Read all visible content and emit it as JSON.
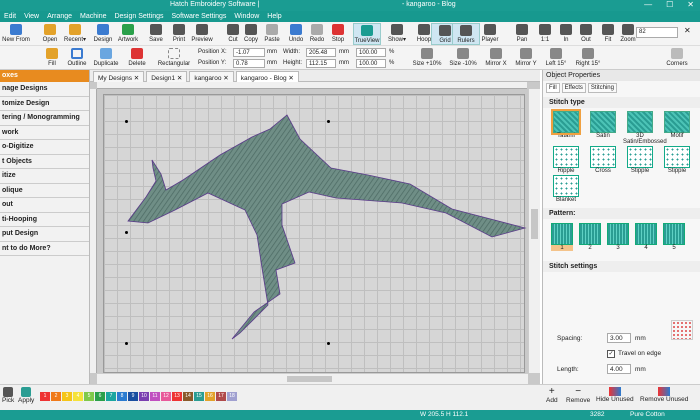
{
  "window": {
    "title_left": "Hatch Embroidery Software |",
    "title_right": "- kangaroo - Blog",
    "controls": [
      "—",
      "☐",
      "✕"
    ]
  },
  "menu": [
    "Edit",
    "View",
    "Arrange",
    "Machine",
    "Design Settings",
    "Software Settings",
    "Window",
    "Help"
  ],
  "toolbar1": [
    {
      "label": "New From",
      "icon": "new-icon",
      "color": "#3b7bd0"
    },
    {
      "label": "Open",
      "icon": "open-folder-icon",
      "color": "#e3a22a"
    },
    {
      "label": "Recent▾",
      "icon": "recent-icon",
      "color": "#e3a22a"
    },
    {
      "label": "Design",
      "icon": "design-icon",
      "color": "#3b7bd0"
    },
    {
      "label": "Artwork",
      "icon": "artwork-icon",
      "color": "#2aa04a"
    },
    {
      "label": "Save",
      "icon": "save-icon",
      "color": "#555"
    },
    {
      "label": "Print",
      "icon": "print-icon",
      "color": "#555"
    },
    {
      "label": "Preview",
      "icon": "preview-icon",
      "color": "#555"
    },
    {
      "label": "Cut",
      "icon": "cut-icon",
      "color": "#555"
    },
    {
      "label": "Copy",
      "icon": "copy-icon",
      "color": "#555"
    },
    {
      "label": "Paste",
      "icon": "paste-icon",
      "color": "#aaa"
    },
    {
      "label": "Undo",
      "icon": "undo-icon",
      "color": "#3b7bd0"
    },
    {
      "label": "Redo",
      "icon": "redo-icon",
      "color": "#aaa"
    },
    {
      "label": "Stop",
      "icon": "stop-icon",
      "color": "#d33"
    },
    {
      "label": "TrueView",
      "icon": "trueview-icon",
      "color": "#1a9c92"
    },
    {
      "label": "Show▾",
      "icon": "show-icon",
      "color": "#555"
    },
    {
      "label": "Hoop",
      "icon": "hoop-icon",
      "color": "#555"
    },
    {
      "label": "Grid",
      "icon": "grid-icon",
      "color": "#555"
    },
    {
      "label": "Rulers",
      "icon": "rulers-icon",
      "color": "#555"
    },
    {
      "label": "Player",
      "icon": "player-icon",
      "color": "#555"
    },
    {
      "label": "Pan",
      "icon": "pan-icon",
      "color": "#555"
    },
    {
      "label": "1:1",
      "icon": "zoom-1to1-icon",
      "color": "#555"
    },
    {
      "label": "In",
      "icon": "zoom-in-icon",
      "color": "#555"
    },
    {
      "label": "Out",
      "icon": "zoom-out-icon",
      "color": "#555"
    },
    {
      "label": "Fit",
      "icon": "zoom-fit-icon",
      "color": "#555"
    },
    {
      "label": "Zoom",
      "icon": "zoom-icon",
      "color": "#555"
    }
  ],
  "toolbar1_active": [
    "TrueView",
    "Grid",
    "Rulers"
  ],
  "zoom_value": "82",
  "toolbar2": {
    "buttons": [
      {
        "label": "Fill"
      },
      {
        "label": "Outline"
      },
      {
        "label": "Duplicate"
      },
      {
        "label": "Delete"
      },
      {
        "label": "Rectangular"
      }
    ],
    "position_x_label": "Position X:",
    "position_x": "-1.07",
    "position_y_label": "Position Y:",
    "position_y": "0.78",
    "unit": "mm",
    "width_label": "Width:",
    "width": "205.48",
    "height_label": "Height:",
    "height": "112.15",
    "scale_w": "100.00",
    "scale_h": "100.00",
    "percent": "%",
    "size_buttons": [
      "Size +10%",
      "Size -10%",
      "Mirror X",
      "Mirror Y",
      "Left 15°",
      "Right 15°",
      "Corners"
    ]
  },
  "left_panel": {
    "header": "oxes",
    "items": [
      "nage Designs",
      "tomize Design",
      "tering / Monogramming",
      "work",
      "o-Digitize",
      "t Objects",
      "itize",
      "olique",
      "out",
      "ti-Hooping",
      "put Design",
      "nt to do More?"
    ]
  },
  "tabs": [
    {
      "label": "My Designs ✕",
      "active": false
    },
    {
      "label": "Design1 ✕",
      "active": false
    },
    {
      "label": "kangaroo ✕",
      "active": false
    },
    {
      "label": "kangaroo - Blog ✕",
      "active": true
    }
  ],
  "right_panel": {
    "title": "Object Properties",
    "tabs": [
      "Fill",
      "Effects",
      "Stitching"
    ],
    "stitch_type_label": "Stitch type",
    "stitch_types": [
      "Tatami",
      "Satin",
      "3D Satin/Embossed",
      "Motif",
      "Ripple",
      "Cross",
      "Stipple",
      "Stipple",
      "Blanket"
    ],
    "pattern_label": "Pattern:",
    "patterns": [
      "1",
      "2",
      "3",
      "4",
      "5"
    ],
    "settings_label": "Stitch settings",
    "spacing_label": "Spacing:",
    "spacing": "3.00",
    "spacing_unit": "mm",
    "travel_label": "Travel on edge",
    "length_label": "Length:",
    "length": "4.00",
    "length_unit": "mm"
  },
  "bottom": {
    "pick_label": "Pick",
    "apply_label": "Apply",
    "swatch_colors": [
      {
        "n": "1",
        "c": "#e33"
      },
      {
        "n": "2",
        "c": "#f07a1a"
      },
      {
        "n": "3",
        "c": "#f5c518"
      },
      {
        "n": "4",
        "c": "#f5e23a"
      },
      {
        "n": "5",
        "c": "#7fc94a"
      },
      {
        "n": "6",
        "c": "#2aa04a"
      },
      {
        "n": "7",
        "c": "#1aa6a0"
      },
      {
        "n": "8",
        "c": "#2a7bd0"
      },
      {
        "n": "9",
        "c": "#1a4fa0"
      },
      {
        "n": "10",
        "c": "#7a3fb0"
      },
      {
        "n": "11",
        "c": "#c04fc0"
      },
      {
        "n": "12",
        "c": "#e85a9a"
      },
      {
        "n": "13",
        "c": "#e33"
      },
      {
        "n": "14",
        "c": "#8a5a2a"
      },
      {
        "n": "15",
        "c": "#2a9d93"
      },
      {
        "n": "16",
        "c": "#e3a22a"
      },
      {
        "n": "17",
        "c": "#b04a4a"
      },
      {
        "n": "18",
        "c": "#a0a0d0"
      }
    ],
    "add_label": "Add",
    "remove_label": "Remove",
    "hide_unused_label": "Hide Unused",
    "remove_unused_label": "Remove Unused"
  },
  "status": {
    "coords": "W 205.5 H 112.1",
    "count": "3282",
    "thread": "Pure Cotton"
  }
}
